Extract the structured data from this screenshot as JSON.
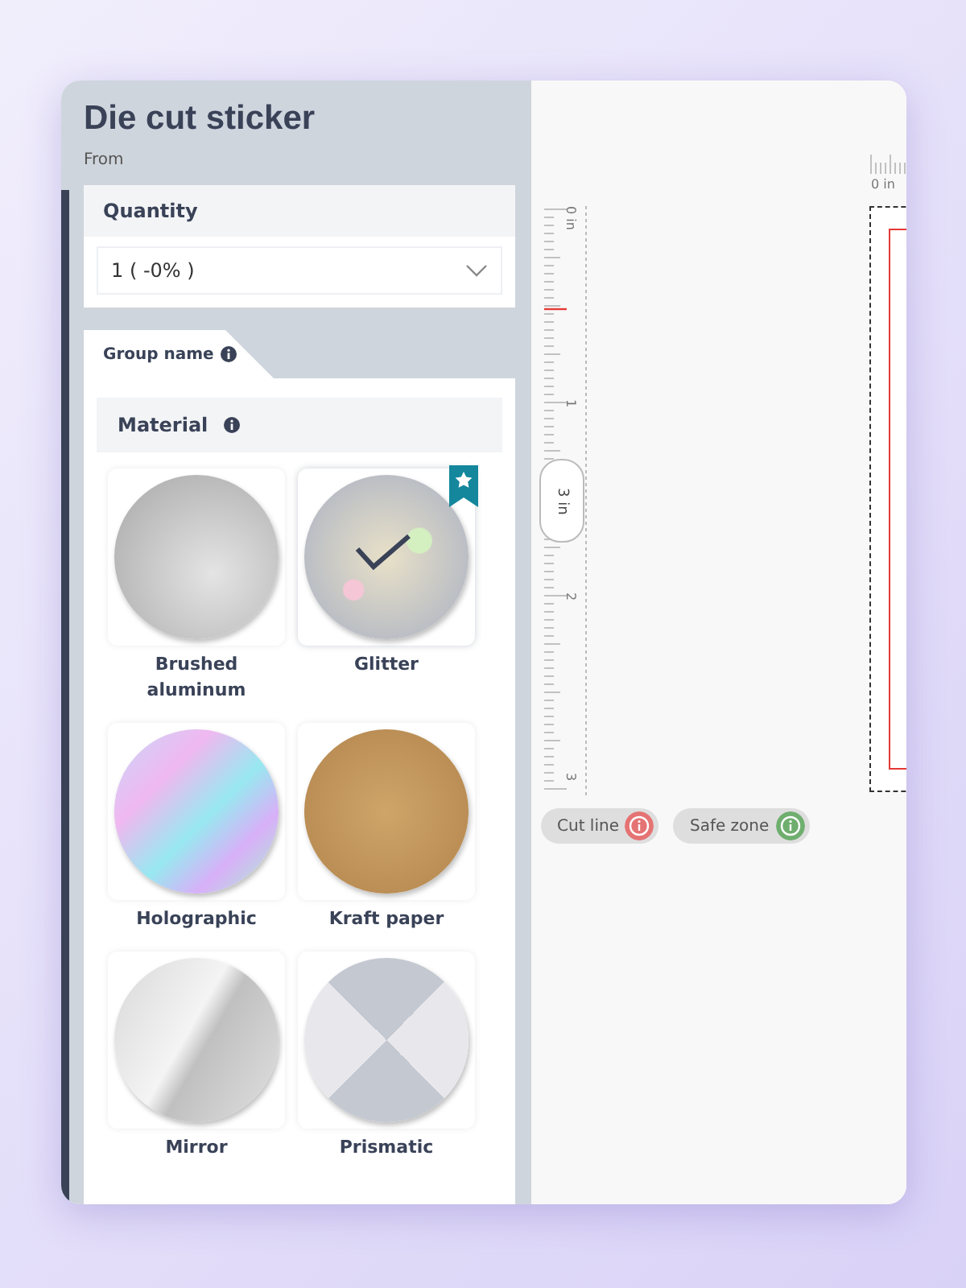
{
  "product": {
    "title": "Die cut sticker",
    "price_label": "From"
  },
  "quantity": {
    "label": "Quantity",
    "value": "1 ( -0% )"
  },
  "group_tab": {
    "label": "Group name"
  },
  "material": {
    "label": "Material",
    "options": [
      {
        "label": "Brushed aluminum",
        "kind": "brushed",
        "selected": false,
        "featured": false
      },
      {
        "label": "Glitter",
        "kind": "glitter",
        "selected": true,
        "featured": true
      },
      {
        "label": "Holographic",
        "kind": "holographic",
        "selected": false,
        "featured": false
      },
      {
        "label": "Kraft paper",
        "kind": "kraft",
        "selected": false,
        "featured": false
      },
      {
        "label": "Mirror",
        "kind": "mirror",
        "selected": false,
        "featured": false
      },
      {
        "label": "Prismatic",
        "kind": "prismatic",
        "selected": false,
        "featured": false
      }
    ]
  },
  "canvas": {
    "vertical_ruler": {
      "labels": [
        "0 in",
        "1",
        "2",
        "3"
      ]
    },
    "size_badge": "3 in",
    "horizontal_ruler": {
      "labels": [
        "0 in"
      ]
    },
    "legend": [
      {
        "label": "Cut line",
        "color": "#e57373"
      },
      {
        "label": "Safe zone",
        "color": "#6fae6f"
      }
    ]
  }
}
